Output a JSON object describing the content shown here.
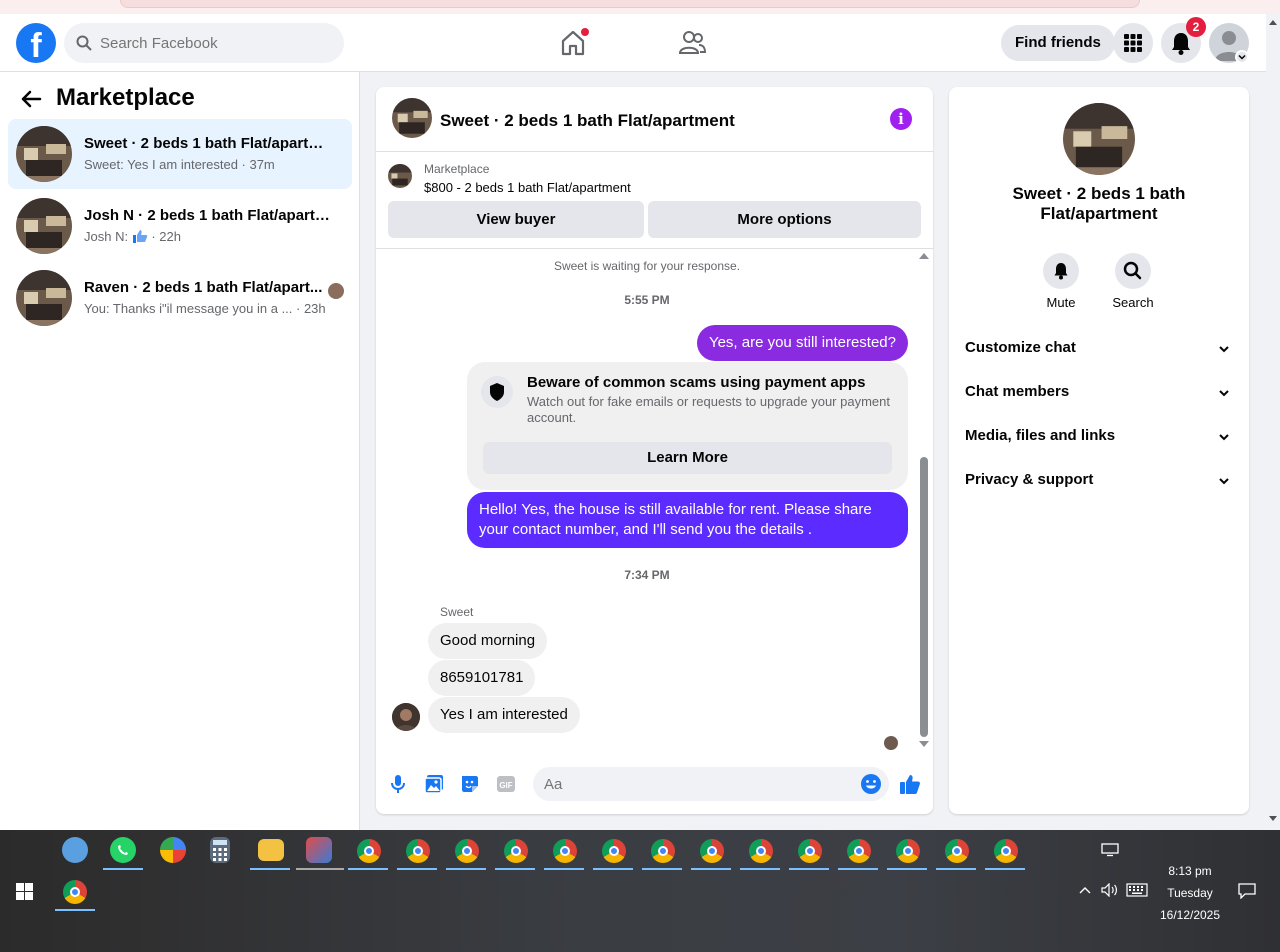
{
  "header": {
    "logo": "f",
    "search_placeholder": "Search Facebook",
    "find_friends": "Find friends",
    "notifications_count": "2"
  },
  "sidebar": {
    "title": "Marketplace",
    "conversations": [
      {
        "title": "Sweet · 2 beds 1 bath Flat/apartme...",
        "subtitle": "Sweet: Yes I am interested · 37m",
        "active": true
      },
      {
        "title": "Josh N · 2 beds 1 bath Flat/apartm...",
        "subtitle_prefix": "Josh N:",
        "subtitle_suffix": "· 22h",
        "icon": "thumbs-up-icon"
      },
      {
        "title": "Raven · 2 beds 1 bath Flat/apart...",
        "subtitle": "You: Thanks i\"il message you in a ... · 23h"
      }
    ]
  },
  "chat": {
    "title": "Sweet · 2 beds 1 bath Flat/apartment",
    "listing_kind": "Marketplace",
    "listing_price": "$800 - 2 beds 1 bath Flat/apartment",
    "view_buyer": "View buyer",
    "more_options": "More options",
    "waiting": "Sweet is waiting for your response.",
    "time1": "5:55 PM",
    "msg_out1": "Yes, are you still interested?",
    "warning_title": "Beware of common scams using payment apps",
    "warning_body": "Watch out for fake emails or requests to upgrade your payment account.",
    "learn_more": "Learn More",
    "msg_out2": "Hello! Yes, the house is still available for rent. Please share your contact number, and I'll send you the details .",
    "time2": "7:34 PM",
    "sender": "Sweet",
    "msg_in1": "Good morning",
    "msg_in2": "8659101781",
    "msg_in3": "Yes I am interested",
    "composer_placeholder": "Aa",
    "accent_color": "#8a2be2"
  },
  "right_panel": {
    "title": "Sweet · 2 beds 1 bath Flat/apartment",
    "mute": "Mute",
    "search": "Search",
    "rows": [
      "Customize chat",
      "Chat members",
      "Media, files and links",
      "Privacy & support"
    ]
  },
  "taskbar": {
    "time": "8:13 pm",
    "day": "Tuesday",
    "date": "16/12/2025"
  }
}
